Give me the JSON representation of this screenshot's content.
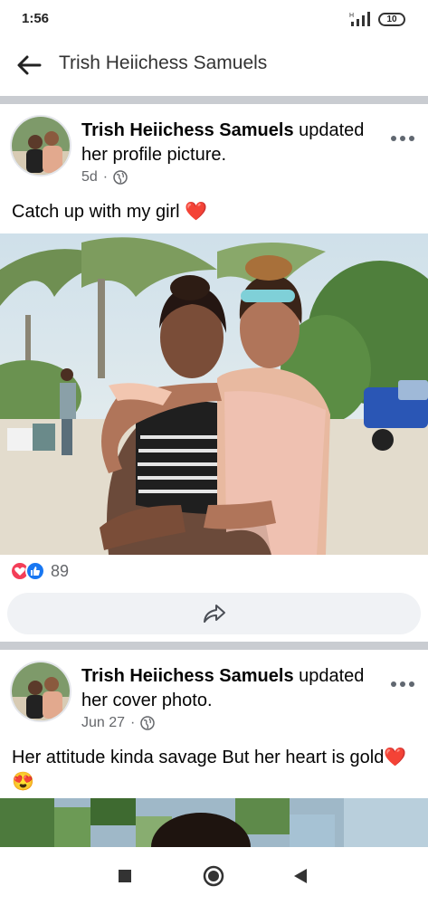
{
  "status_bar": {
    "time": "1:56",
    "battery": "10",
    "network": "H"
  },
  "header": {
    "title": "Trish Heiichess Samuels",
    "back_icon": "arrow-left-icon"
  },
  "posts": [
    {
      "author": "Trish Heiichess Samuels",
      "action": " updated her profile picture.",
      "time": "5d",
      "separator": "·",
      "privacy_icon": "globe-icon",
      "caption": "Catch up with my girl",
      "caption_emoji": "❤️",
      "reactions": {
        "count": "89",
        "types": [
          "love",
          "like"
        ]
      },
      "share_icon": "share-arrow-icon"
    },
    {
      "author": "Trish Heiichess Samuels",
      "action": " updated her cover photo.",
      "time": "Jun 27",
      "separator": "·",
      "privacy_icon": "globe-icon",
      "caption": "Her attitude kinda savage But her heart is gold",
      "caption_emoji_1": "❤️",
      "caption_emoji_2": "😍"
    }
  ],
  "nav_bar": {
    "items": [
      "recents-square-icon",
      "home-circle-icon",
      "back-triangle-icon"
    ]
  }
}
